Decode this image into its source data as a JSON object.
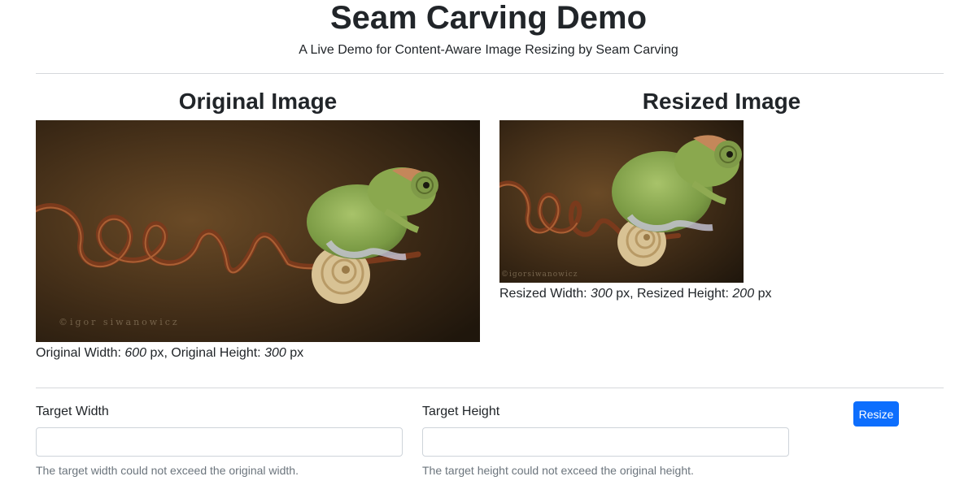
{
  "header": {
    "title": "Seam Carving Demo",
    "subtitle": "A Live Demo for Content-Aware Image Resizing by Seam Carving"
  },
  "original": {
    "heading": "Original Image",
    "width_label": "Original Width:",
    "width_value": "600",
    "height_label": ", Original Height:",
    "height_value": "300",
    "unit": "px",
    "watermark": "©igor siwanowicz"
  },
  "resized": {
    "heading": "Resized Image",
    "width_label": "Resized Width:",
    "width_value": "300",
    "height_label": ", Resized Height:",
    "height_value": "200",
    "unit": "px",
    "watermark": "©igorsiwanowicz"
  },
  "form": {
    "width_label": "Target Width",
    "width_value": "",
    "width_help": "The target width could not exceed the original width.",
    "height_label": "Target Height",
    "height_value": "",
    "height_help": "The target height could not exceed the original height.",
    "submit_label": "Resize"
  },
  "colors": {
    "primary": "#0d6efd",
    "muted": "#6c757d",
    "text": "#212529"
  }
}
